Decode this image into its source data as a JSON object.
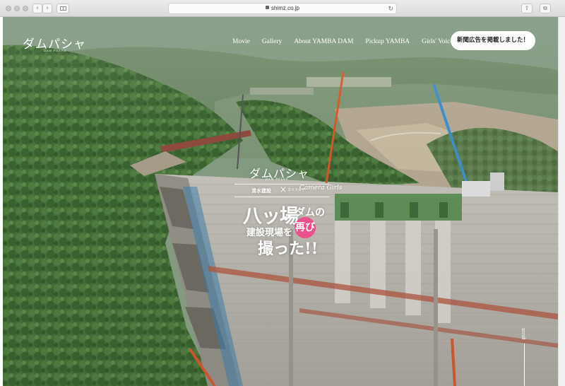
{
  "browser": {
    "url": "shimz.co.jp",
    "back_glyph": "‹",
    "forward_glyph": "›",
    "reload_glyph": "↻",
    "share_glyph": "⇧",
    "tabs_glyph": "⧉"
  },
  "site": {
    "logo": "ダムパシャ",
    "logo_sub": "DAM PASHA"
  },
  "nav": {
    "items": [
      "Movie",
      "Gallery",
      "About YAMBA DAM",
      "Pickup YAMBA",
      "Girls' Voice"
    ],
    "cta_label": "新聞広告を掲載しました！"
  },
  "hero": {
    "logo": "ダムパシャ",
    "logo_sub": "DAM PASHA",
    "company1": "清水建設",
    "cross": "×",
    "company2": "カメラ女子",
    "company3": "Camera Girls",
    "title_big": "八ッ場",
    "title_small": "ダムの",
    "title_line2": "建設現場を",
    "title_re": "再び",
    "title_line3": "撮った!!",
    "scroll": "scroll"
  },
  "colors": {
    "accent_pink": "#ec4f8c",
    "forest": "#3f6b35",
    "concrete": "#b3b1a8"
  }
}
